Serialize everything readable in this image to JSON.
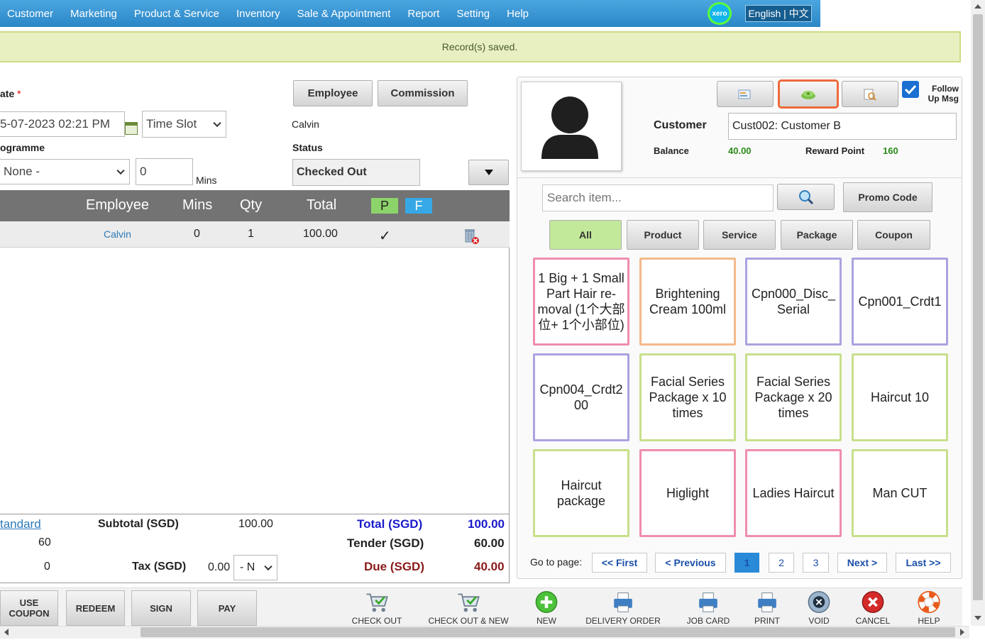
{
  "nav": {
    "items": [
      "Customer",
      "Marketing",
      "Product & Service",
      "Inventory",
      "Sale & Appointment",
      "Report",
      "Setting",
      "Help"
    ],
    "xero": "xero",
    "language": "English | 中文"
  },
  "notice": "Record(s) saved.",
  "form": {
    "date_label": "ate",
    "required_mark": "*",
    "date_value": "5-07-2023 02:21 PM",
    "timeslot_value": "Time Slot",
    "programme_label": "ogramme",
    "programme_value": "None -",
    "mins_value": "0",
    "mins_label": "Mins",
    "employee_button": "Employee",
    "commission_button": "Commission",
    "employee_name": "Calvin",
    "status_label": "Status",
    "status_value": "Checked Out"
  },
  "table": {
    "headers": {
      "employee": "Employee",
      "mins": "Mins",
      "qty": "Qty",
      "total": "Total",
      "p": "P",
      "f": "F"
    },
    "rows": [
      {
        "employee": "Calvin",
        "mins": "0",
        "qty": "1",
        "total": "100.00",
        "check": "✓"
      }
    ]
  },
  "totals": {
    "standard_link": "tandard",
    "left_value_1": "60",
    "left_value_2": "0",
    "subtotal_label": "Subtotal (SGD)",
    "subtotal_value": "100.00",
    "tax_label": "Tax (SGD)",
    "tax_value": "0.00",
    "tax_select": "- N",
    "total_label": "Total (SGD)",
    "total_value": "100.00",
    "tender_label": "Tender (SGD)",
    "tender_value": "60.00",
    "due_label": "Due (SGD)",
    "due_value": "40.00"
  },
  "customer": {
    "follow_up_line1": "Follow",
    "follow_up_line2": "Up Msg",
    "customer_label": "Customer",
    "customer_value": "Cust002: Customer B",
    "balance_label": "Balance",
    "balance_value": "40.00",
    "reward_label": "Reward Point",
    "reward_value": "160"
  },
  "search": {
    "placeholder": "Search item...",
    "promo_button": "Promo Code"
  },
  "filters": [
    "All",
    "Product",
    "Service",
    "Package",
    "Coupon"
  ],
  "items": [
    "1 Big + 1 Small Part Hair re-moval (1个大部位+ 1个小部位)",
    "Brightening Cream 100ml",
    "Cpn000_Disc_ Serial",
    "Cpn001_Crdt1",
    "Cpn004_Crdt2 00",
    "Facial Series Package x 10 times",
    "Facial Series Package x 20 times",
    "Haircut 10",
    "Haircut package",
    "Higlight",
    "Ladies Haircut",
    "Man CUT"
  ],
  "item_colors": [
    "#f08cb0",
    "#f4b98a",
    "#a9a3e0",
    "#a9a3e0",
    "#a9a3e0",
    "#c7e08a",
    "#c7e08a",
    "#c7e08a",
    "#c7e08a",
    "#f08cb0",
    "#f08cb0",
    "#c7e08a"
  ],
  "pagination": {
    "label": "Go to page:",
    "first": "<< First",
    "previous": "< Previous",
    "pages": [
      "1",
      "2",
      "3"
    ],
    "next": "Next >",
    "last": "Last >>"
  },
  "bottom": {
    "buttons": [
      "USE COUPON",
      "REDEEM",
      "SIGN",
      "PAY"
    ],
    "tools": [
      "CHECK OUT",
      "CHECK OUT & NEW",
      "NEW",
      "DELIVERY ORDER",
      "JOB CARD",
      "PRINT",
      "VOID",
      "CANCEL",
      "HELP"
    ]
  },
  "colors": {
    "nav": "#2b86c7",
    "notice_bg": "#e8f0c2",
    "total_blue": "#1a1acc",
    "due_red": "#8b1a1a",
    "balance_green": "#2a8a1a",
    "all_filter": "#c2e89a"
  }
}
